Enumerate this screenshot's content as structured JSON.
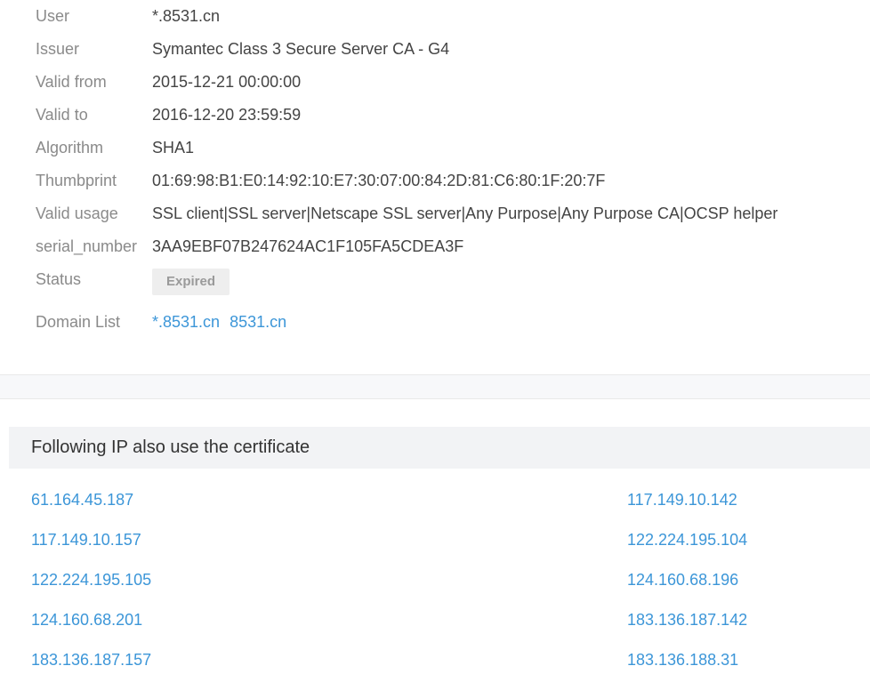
{
  "certificate": {
    "user_label": "User",
    "user_value": "*.8531.cn",
    "issuer_label": "Issuer",
    "issuer_value": "Symantec Class 3 Secure Server CA - G4",
    "valid_from_label": "Valid from",
    "valid_from_value": "2015-12-21 00:00:00",
    "valid_to_label": "Valid to",
    "valid_to_value": "2016-12-20 23:59:59",
    "algorithm_label": "Algorithm",
    "algorithm_value": "SHA1",
    "thumbprint_label": "Thumbprint",
    "thumbprint_value": "01:69:98:B1:E0:14:92:10:E7:30:07:00:84:2D:81:C6:80:1F:20:7F",
    "valid_usage_label": "Valid usage",
    "valid_usage_value": "SSL client|SSL server|Netscape SSL server|Any Purpose|Any Purpose CA|OCSP helper",
    "serial_label": "serial_number",
    "serial_value": "3AA9EBF07B247624AC1F105FA5CDEA3F",
    "status_label": "Status",
    "status_value": "Expired",
    "domain_list_label": "Domain List",
    "domains": [
      "*.8531.cn",
      "8531.cn"
    ]
  },
  "ip_section": {
    "title": "Following IP also use the certificate",
    "ips": [
      "61.164.45.187",
      "117.149.10.142",
      "117.149.10.157",
      "122.224.195.104",
      "122.224.195.105",
      "124.160.68.196",
      "124.160.68.201",
      "183.136.187.142",
      "183.136.187.157",
      "183.136.188.31"
    ]
  },
  "colors": {
    "link": "#3c96d8",
    "label": "#8a8a8a",
    "value": "#444444",
    "badge_bg": "#eeeeee"
  }
}
